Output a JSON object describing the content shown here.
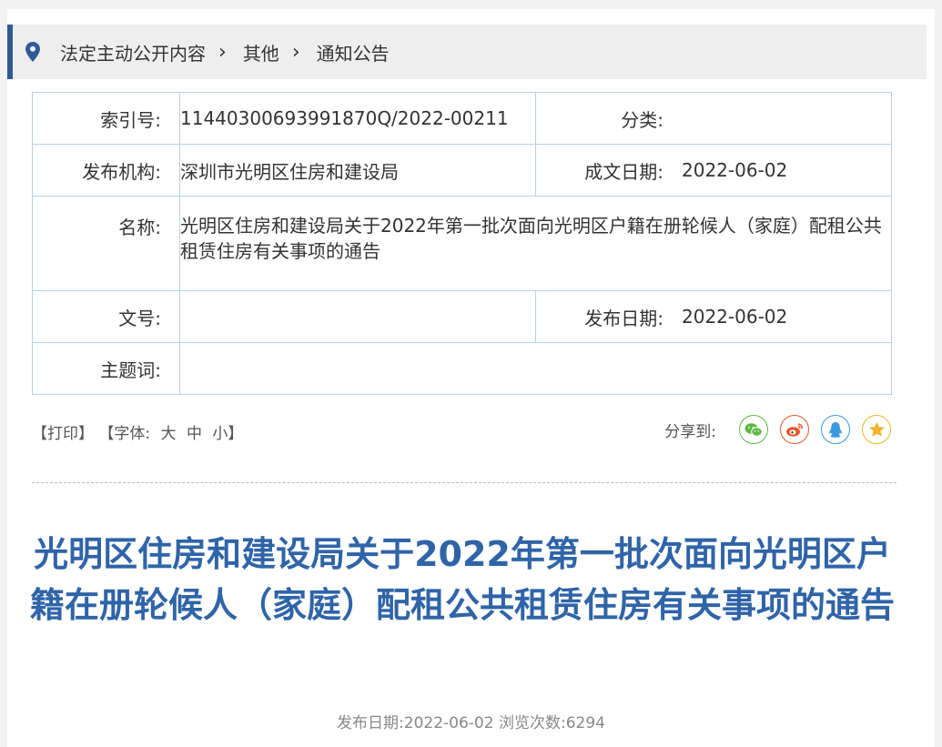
{
  "breadcrumb": {
    "items": [
      "法定主动公开内容",
      "其他",
      "通知公告"
    ],
    "separator": "›"
  },
  "meta": {
    "index_label": "索引号:",
    "index_value": "11440300693991870Q/2022-00211",
    "category_label": "分类:",
    "category_value": "",
    "org_label": "发布机构:",
    "org_value": "深圳市光明区住房和建设局",
    "written_date_label": "成文日期:",
    "written_date_value": "2022-06-02",
    "name_label": "名称:",
    "name_value": "光明区住房和建设局关于2022年第一批次面向光明区户籍在册轮候人（家庭）配租公共租赁住房有关事项的通告",
    "doc_no_label": "文号:",
    "doc_no_value": "",
    "publish_date_label": "发布日期:",
    "publish_date_value": "2022-06-02",
    "keywords_label": "主题词:",
    "keywords_value": ""
  },
  "tools": {
    "print": "【打印】",
    "font_open": "【字体:",
    "font_large": "大",
    "font_medium": "中",
    "font_small": "小】"
  },
  "share": {
    "label": "分享到:",
    "icons": [
      "wechat-icon",
      "weibo-icon",
      "qq-icon",
      "qzone-icon"
    ],
    "colors": {
      "wechat": "#5fb844",
      "weibo": "#e8562e",
      "qq": "#3a9ae0",
      "qzone": "#f2b22e"
    }
  },
  "article": {
    "title": "光明区住房和建设局关于2022年第一批次面向光明区户籍在册轮候人（家庭）配租公共租赁住房有关事项的通告",
    "publish_label": "发布日期:",
    "publish_date": "2022-06-02",
    "views_label": "浏览次数:",
    "views": "6294"
  },
  "colors": {
    "accent": "#2f5b94",
    "title": "#2f64a8",
    "table_border": "#b9d1e3"
  }
}
